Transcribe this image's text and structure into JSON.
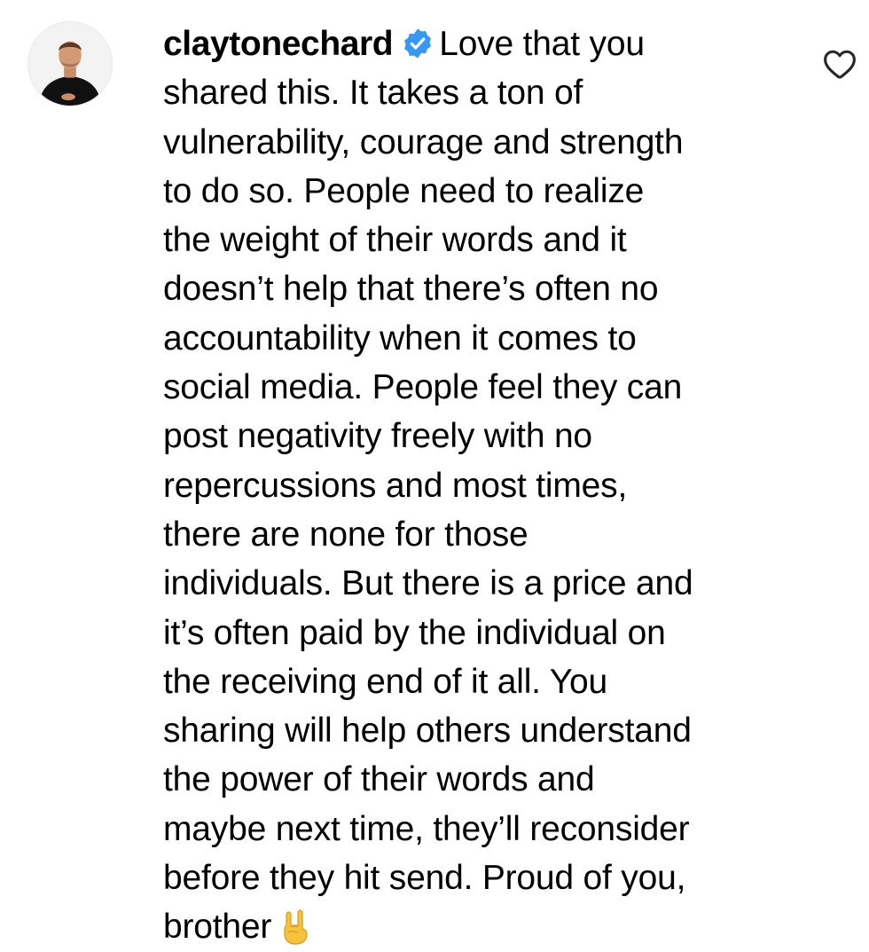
{
  "comment": {
    "username": "claytonechard",
    "verified": true,
    "text_lines": [
      "Love that you",
      "shared this. It takes a ton of",
      "vulnerability, courage and strength",
      "to do so. People need to realize",
      "the weight of their words and it",
      "doesn’t help that there’s often no",
      "accountability when it comes to",
      "social media. People feel they can",
      "post negativity freely with no",
      "repercussions and most times,",
      "there are none for those",
      "individuals. But there is a price and",
      "it’s often paid by the individual on",
      "the receiving end of it all. You",
      "sharing will help others understand",
      "the power of their words and",
      "maybe next time, they’ll reconsider",
      "before they hit send. Proud of you,",
      "brother"
    ],
    "trailing_emoji": "🤘",
    "icons": {
      "verified": "verified-badge-icon",
      "like": "heart-outline-icon",
      "emoji": "sign-of-the-horns-emoji"
    },
    "colors": {
      "verified_badge": "#3897f0",
      "text": "#000000",
      "like_icon": "#262626"
    }
  }
}
